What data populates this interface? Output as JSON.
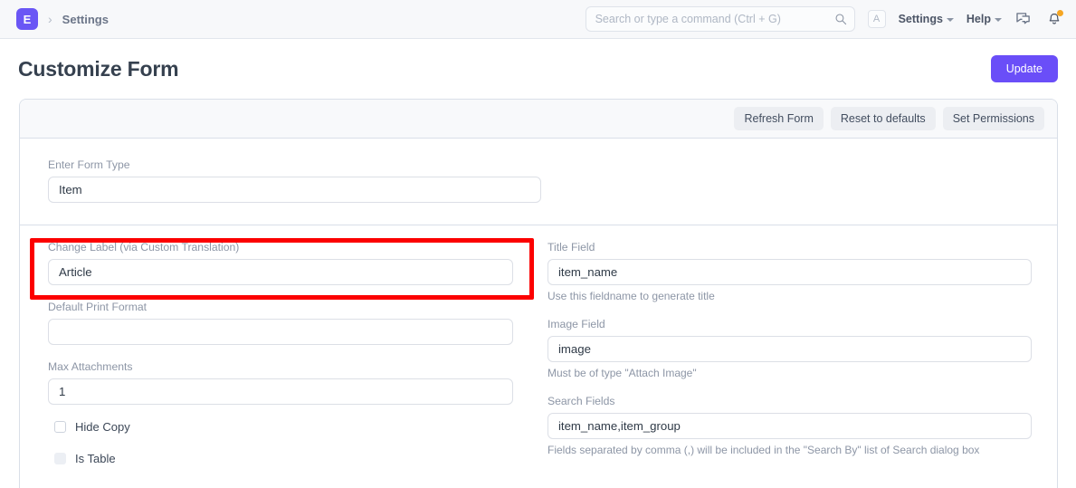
{
  "navbar": {
    "logo_letter": "E",
    "breadcrumb": "Settings",
    "search": {
      "placeholder": "Search or type a command (Ctrl + G)",
      "value": ""
    },
    "avatar_letter": "A",
    "menu_settings": "Settings",
    "menu_help": "Help",
    "icons": {
      "search": "search-icon",
      "chat": "chat-icon",
      "bell": "bell-icon"
    }
  },
  "page": {
    "title": "Customize Form",
    "primary_action": "Update"
  },
  "toolbar": {
    "buttons": [
      "Refresh Form",
      "Reset to defaults",
      "Set Permissions"
    ]
  },
  "form": {
    "form_type": {
      "label": "Enter Form Type",
      "value": "Item"
    },
    "left_column": [
      {
        "label": "Change Label (via Custom Translation)",
        "value": "Article",
        "help": ""
      },
      {
        "label": "Default Print Format",
        "value": "",
        "help": ""
      },
      {
        "label": "Max Attachments",
        "value": "1",
        "help": ""
      }
    ],
    "checkboxes": [
      {
        "label": "Hide Copy",
        "checked": false,
        "disabled": false
      },
      {
        "label": "Is Table",
        "checked": false,
        "disabled": true
      }
    ],
    "right_column": [
      {
        "label": "Title Field",
        "value": "item_name",
        "help": "Use this fieldname to generate title"
      },
      {
        "label": "Image Field",
        "value": "image",
        "help": "Must be of type \"Attach Image\""
      },
      {
        "label": "Search Fields",
        "value": "item_name,item_group",
        "help": "Fields separated by comma (,) will be included in the \"Search By\" list of Search dialog box"
      }
    ]
  },
  "annotation": {
    "highlight_color": "#fc0000",
    "target": "change-label-field"
  },
  "colors": {
    "brand_purple": "#6a4ef8",
    "logo_purple": "#6a56f5",
    "navbar_bg": "#f7f8fa",
    "border": "#d9dfe8",
    "notification_dot": "#f5a623"
  }
}
